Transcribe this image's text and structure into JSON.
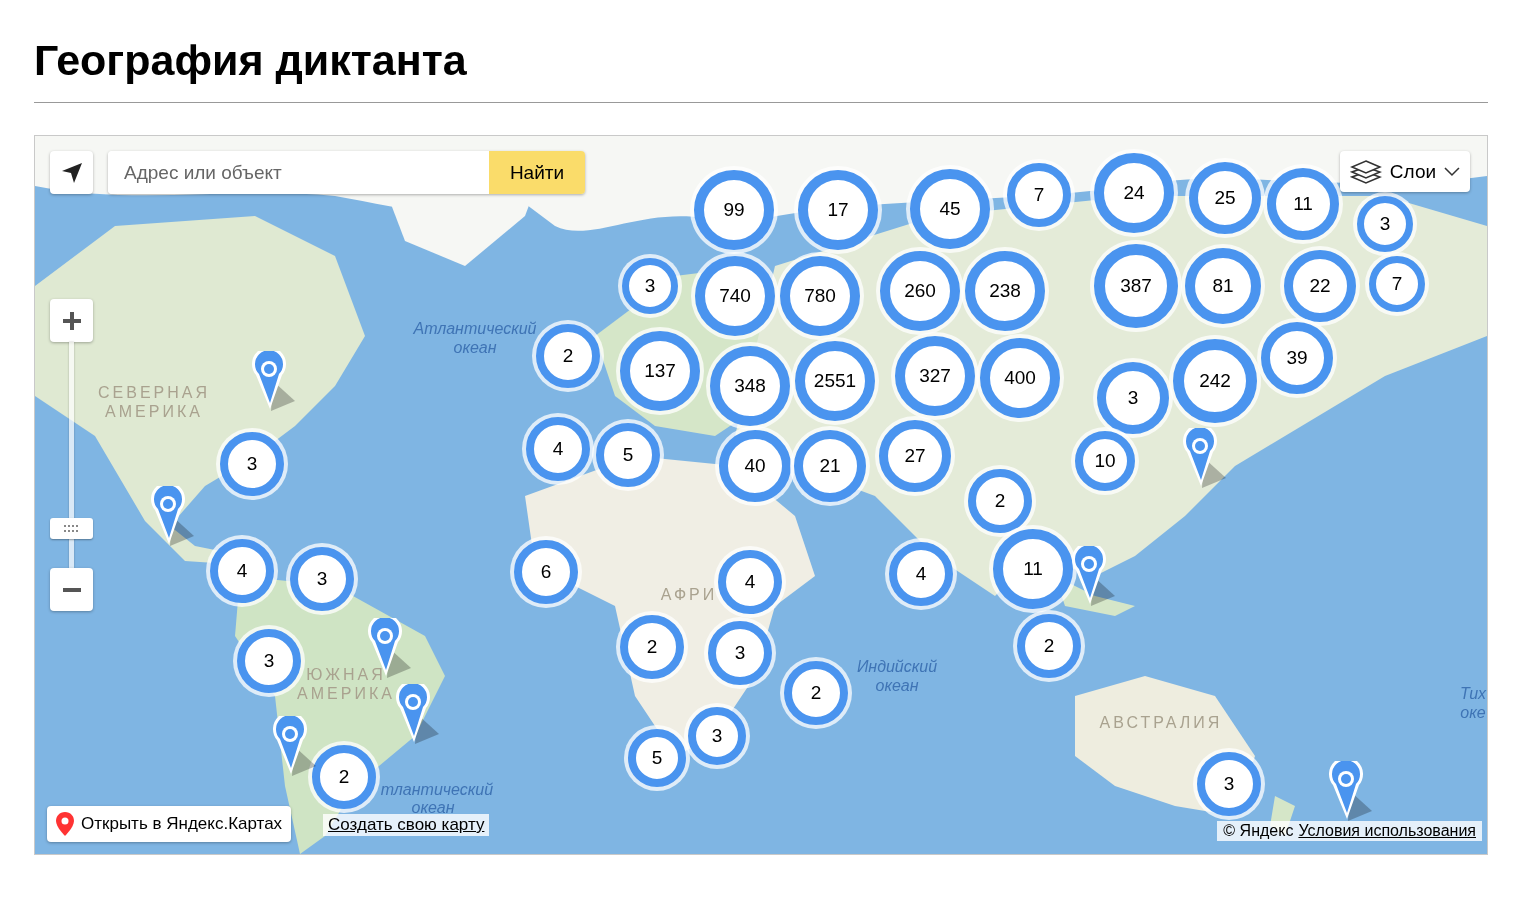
{
  "title": "География диктанта",
  "map": {
    "search": {
      "placeholder": "Адрес или объект",
      "button": "Найти"
    },
    "layers_button": "Слои",
    "zoom": {
      "level": 0.14
    },
    "labels": [
      {
        "kind": "ocean",
        "text": "Атлантический"
      },
      {
        "kind": "ocean",
        "text": "океан"
      },
      {
        "kind": "continent",
        "text": "СЕВЕРНАЯ"
      },
      {
        "kind": "continent",
        "text": "АМЕРИКА"
      },
      {
        "kind": "continent",
        "text": "АФРИ"
      },
      {
        "kind": "ocean",
        "text": "Индийский"
      },
      {
        "kind": "ocean",
        "text": "океан"
      },
      {
        "kind": "continent",
        "text": "ЮЖНАЯ"
      },
      {
        "kind": "continent",
        "text": "АМЕРИКА"
      },
      {
        "kind": "continent",
        "text": "АВСТРАЛИЯ"
      },
      {
        "kind": "ocean",
        "text": "Тих"
      },
      {
        "kind": "ocean",
        "text": "оке"
      },
      {
        "kind": "ocean",
        "text": "тлантический"
      },
      {
        "kind": "ocean",
        "text": "океан"
      }
    ],
    "clusters": [
      {
        "count": "99"
      },
      {
        "count": "17"
      },
      {
        "count": "45"
      },
      {
        "count": "7"
      },
      {
        "count": "24"
      },
      {
        "count": "25"
      },
      {
        "count": "11"
      },
      {
        "count": "3"
      },
      {
        "count": "3"
      },
      {
        "count": "740"
      },
      {
        "count": "780"
      },
      {
        "count": "260"
      },
      {
        "count": "238"
      },
      {
        "count": "387"
      },
      {
        "count": "81"
      },
      {
        "count": "22"
      },
      {
        "count": "7"
      },
      {
        "count": "2"
      },
      {
        "count": "137"
      },
      {
        "count": "348"
      },
      {
        "count": "2551"
      },
      {
        "count": "327"
      },
      {
        "count": "400"
      },
      {
        "count": "3"
      },
      {
        "count": "242"
      },
      {
        "count": "39"
      },
      {
        "count": "3"
      },
      {
        "count": "4"
      },
      {
        "count": "5"
      },
      {
        "count": "40"
      },
      {
        "count": "21"
      },
      {
        "count": "27"
      },
      {
        "count": "10"
      },
      {
        "count": "2"
      },
      {
        "count": "4"
      },
      {
        "count": "3"
      },
      {
        "count": "6"
      },
      {
        "count": "4"
      },
      {
        "count": "4"
      },
      {
        "count": "11"
      },
      {
        "count": "3"
      },
      {
        "count": "2"
      },
      {
        "count": "3"
      },
      {
        "count": "2"
      },
      {
        "count": "2"
      },
      {
        "count": "2"
      },
      {
        "count": "5"
      },
      {
        "count": "3"
      },
      {
        "count": "3"
      }
    ],
    "open_button": "Открыть в Яндекс.Картах",
    "create_link": "Создать свою карту",
    "copyright": "© Яндекс",
    "terms_link": "Условия использования"
  }
}
